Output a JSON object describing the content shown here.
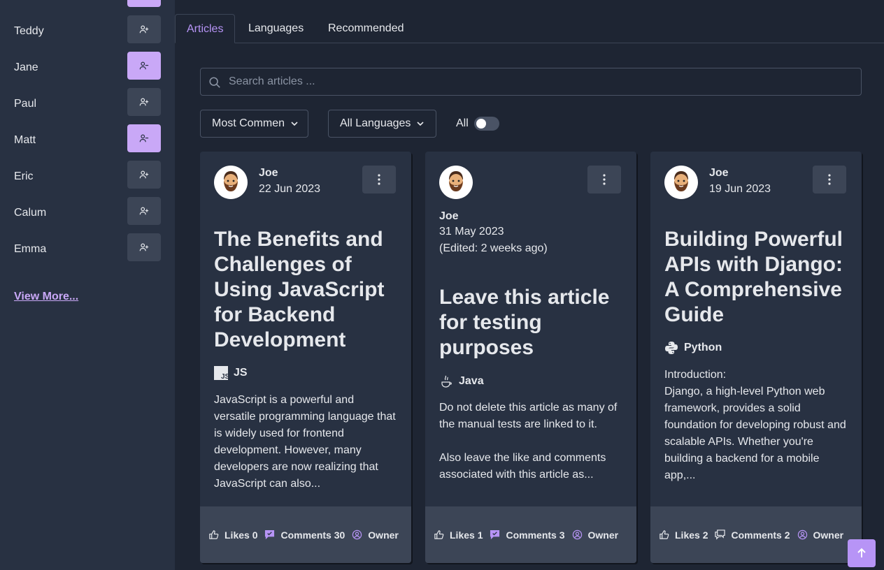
{
  "sidebar": {
    "friends": [
      {
        "name": "Teddy",
        "action": "add",
        "icon": "user-plus-icon"
      },
      {
        "name": "Jane",
        "action": "remove",
        "icon": "user-minus-icon"
      },
      {
        "name": "Paul",
        "action": "add",
        "icon": "user-plus-icon"
      },
      {
        "name": "Matt",
        "action": "remove",
        "icon": "user-minus-icon"
      },
      {
        "name": "Eric",
        "action": "add",
        "icon": "user-plus-icon"
      },
      {
        "name": "Calum",
        "action": "add",
        "icon": "user-plus-icon"
      },
      {
        "name": "Emma",
        "action": "add",
        "icon": "user-plus-icon"
      }
    ],
    "view_more": "View More..."
  },
  "tabs": [
    {
      "label": "Articles",
      "active": true
    },
    {
      "label": "Languages",
      "active": false
    },
    {
      "label": "Recommended",
      "active": false
    }
  ],
  "search": {
    "placeholder": "Search articles ...",
    "value": ""
  },
  "filters": {
    "sort": "Most Commen",
    "language": "All Languages",
    "toggle_label": "All",
    "toggle_on": false
  },
  "cards": [
    {
      "author": "Joe",
      "date": "22 Jun 2023",
      "edited": "",
      "title": "The Benefits and Challenges of Using JavaScript for Backend Development",
      "language": "JS",
      "language_icon": "js-icon",
      "body": "JavaScript is a powerful and versatile programming language that is widely used for frontend development. However, many developers are now realizing that JavaScript can also...",
      "likes": "Likes 0",
      "comments": "Comments 30",
      "owner": "Owner"
    },
    {
      "author": "Joe",
      "date": "31 May 2023",
      "edited": "(Edited: 2 weeks ago)",
      "title": "Leave this article for testing purposes",
      "language": "Java",
      "language_icon": "java-icon",
      "body": "Do not delete this article as many of the manual tests are linked to it.\n\nAlso leave the like and comments associated with this article as...",
      "likes": "Likes 1",
      "comments": "Comments 3",
      "owner": "Owner"
    },
    {
      "author": "Joe",
      "date": "19 Jun 2023",
      "edited": "",
      "title": "Building Powerful APIs with Django: A Comprehensive Guide",
      "language": "Python",
      "language_icon": "python-icon",
      "body": "Introduction:\nDjango, a high-level Python web framework, provides a solid foundation for developing robust and scalable APIs. Whether you're building a backend for a mobile app,...",
      "likes": "Likes 2",
      "comments": "Comments 2",
      "owner": "Owner"
    }
  ],
  "colors": {
    "accent": "#b794f6",
    "background": "#1e2533",
    "sidebar": "#283142",
    "card": "#283142",
    "footer": "#3c4556"
  }
}
